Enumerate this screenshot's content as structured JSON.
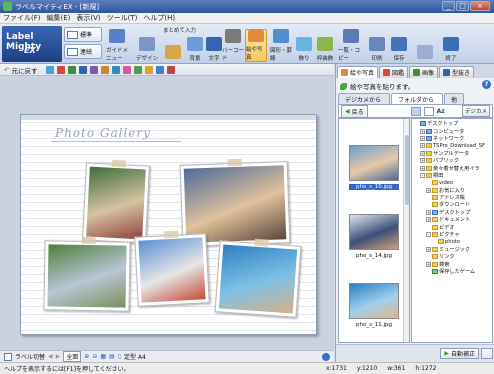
{
  "window": {
    "title": "ラベルマイティEX - [新規]",
    "controls": {
      "minimize": "_",
      "maximize": "□",
      "close": "×"
    }
  },
  "menu": [
    "ファイル(F)",
    "編集(E)",
    "表示(V)",
    "ツール(T)",
    "ヘルプ(H)"
  ],
  "ribbon": {
    "logo_line1": "Label Mighty",
    "logo_line2": "EX",
    "mode_buttons": [
      "標準",
      "連続"
    ],
    "top_label": "まとめて入力",
    "buttons": [
      {
        "label": "ガイドメニュー",
        "color": "#5b7fc4"
      },
      {
        "label": "デザイン",
        "color": "#7b96c9"
      },
      {
        "label": "",
        "color": "#d8a64a"
      },
      {
        "label": "背景",
        "color": "#6c9bd8"
      },
      {
        "label": "文字",
        "color": "#3763b4"
      },
      {
        "label": "バーコード",
        "color": "#7a7a7a"
      },
      {
        "label": "絵や写真",
        "color": "#e28b3a"
      },
      {
        "label": "図形・罫線",
        "color": "#4f8fcf"
      },
      {
        "label": "飾り",
        "color": "#6ab2e0"
      },
      {
        "label": "枠装飾",
        "color": "#8db64a"
      },
      {
        "label": "一覧・コピー",
        "color": "#5d7bb3"
      },
      {
        "label": "印刷",
        "color": "#6b86b8"
      },
      {
        "label": "保存",
        "color": "#4473b9"
      },
      {
        "label": "",
        "color": "#9aaed0"
      },
      {
        "label": "終了",
        "color": "#3d6fb5"
      }
    ]
  },
  "toolbar": {
    "undo_label": "元に戻す",
    "tool_colors": [
      "#4aa3d8",
      "#d24a3a",
      "#3c8f3a",
      "#2f63b5",
      "#7c5bb0",
      "#c98a2e",
      "#2e8fbf",
      "#d65c9b",
      "#4a9e4a",
      "#e0a030",
      "#3f7fd0",
      "#b84a4a"
    ]
  },
  "canvas": {
    "gallery_title": "Photo Gallery",
    "photos": [
      {
        "name": "flute-girls-photo",
        "colors": [
          "#3d6d3d",
          "#d6c3a1",
          "#8f3f3f"
        ]
      },
      {
        "name": "laughing-kids-photo",
        "colors": [
          "#4d6b99",
          "#e1c29c",
          "#5c463c"
        ]
      },
      {
        "name": "sports-field-photo",
        "colors": [
          "#4c7f3a",
          "#b9c6d6",
          "#7a8f5a"
        ]
      },
      {
        "name": "class-group-photo",
        "colors": [
          "#5b8fd6",
          "#e6e6e6",
          "#c84a3a"
        ]
      },
      {
        "name": "swimming-pool-photo",
        "colors": [
          "#2e7fbf",
          "#7ec1e6",
          "#d6b08a"
        ]
      }
    ]
  },
  "bottom_tools": {
    "label_switch": "ラベル切替",
    "full_view": "全面",
    "paper": "定型 A4"
  },
  "status": {
    "message": "ヘルプを表示するには[F1]を押してください。",
    "coords": [
      "x:1731",
      "y:1210",
      "w:361",
      "h:1272"
    ]
  },
  "panel": {
    "tabs": [
      "絵や写真",
      "図鑑",
      "画像",
      "型抜き"
    ],
    "hint": "絵や写真を貼ります。",
    "help": "?",
    "subtabs": [
      "デジカメから",
      "フォルダから",
      "他"
    ],
    "back": "戻る",
    "sort": "Az",
    "digicame": "デジカメ",
    "thumbnails": [
      {
        "name": "pho_s_10.jpg",
        "selected": true,
        "colors": [
          "#6f9fcf",
          "#e6c9a8",
          "#4a6a9a"
        ]
      },
      {
        "name": "pho_s_14.jpg",
        "selected": false,
        "colors": [
          "#dfe7ef",
          "#3b4f7a",
          "#cfa27a"
        ]
      },
      {
        "name": "pho_s_11.jpg",
        "selected": false,
        "colors": [
          "#2e7fbf",
          "#9fd0ec",
          "#e0b48d"
        ]
      }
    ],
    "tree": [
      {
        "label": "デスクトップ",
        "indent": 0,
        "icon": "blue",
        "pm": ""
      },
      {
        "label": "コンピュータ",
        "indent": 1,
        "icon": "blue",
        "pm": "+"
      },
      {
        "label": "ネットワーク",
        "indent": 1,
        "icon": "blue",
        "pm": "+"
      },
      {
        "label": "TSPro_Download_SF",
        "indent": 1,
        "icon": "",
        "pm": "+"
      },
      {
        "label": "サンプルデータ",
        "indent": 1,
        "icon": "",
        "pm": "+"
      },
      {
        "label": "パブリック",
        "indent": 1,
        "icon": "",
        "pm": "+"
      },
      {
        "label": "楽々着せ替え用イラ",
        "indent": 1,
        "icon": "",
        "pm": "+"
      },
      {
        "label": "桐田",
        "indent": 1,
        "icon": "",
        "pm": "-"
      },
      {
        "label": "video",
        "indent": 2,
        "icon": "",
        "pm": ""
      },
      {
        "label": "お気に入り",
        "indent": 2,
        "icon": "",
        "pm": "+"
      },
      {
        "label": "アドレス帳",
        "indent": 2,
        "icon": "",
        "pm": ""
      },
      {
        "label": "ダウンロード",
        "indent": 2,
        "icon": "",
        "pm": ""
      },
      {
        "label": "デスクトップ",
        "indent": 2,
        "icon": "blue",
        "pm": "+"
      },
      {
        "label": "ドキュメント",
        "indent": 2,
        "icon": "",
        "pm": "+"
      },
      {
        "label": "ビデオ",
        "indent": 2,
        "icon": "",
        "pm": ""
      },
      {
        "label": "ピクチャ",
        "indent": 2,
        "icon": "",
        "pm": "-"
      },
      {
        "label": "photo",
        "indent": 3,
        "icon": "",
        "pm": ""
      },
      {
        "label": "ミュージック",
        "indent": 2,
        "icon": "",
        "pm": "+"
      },
      {
        "label": "リンク",
        "indent": 2,
        "icon": "",
        "pm": ""
      },
      {
        "label": "検索",
        "indent": 2,
        "icon": "",
        "pm": "+"
      },
      {
        "label": "保存したゲーム",
        "indent": 2,
        "icon": "green",
        "pm": ""
      }
    ],
    "auto_label": "自動補正"
  }
}
